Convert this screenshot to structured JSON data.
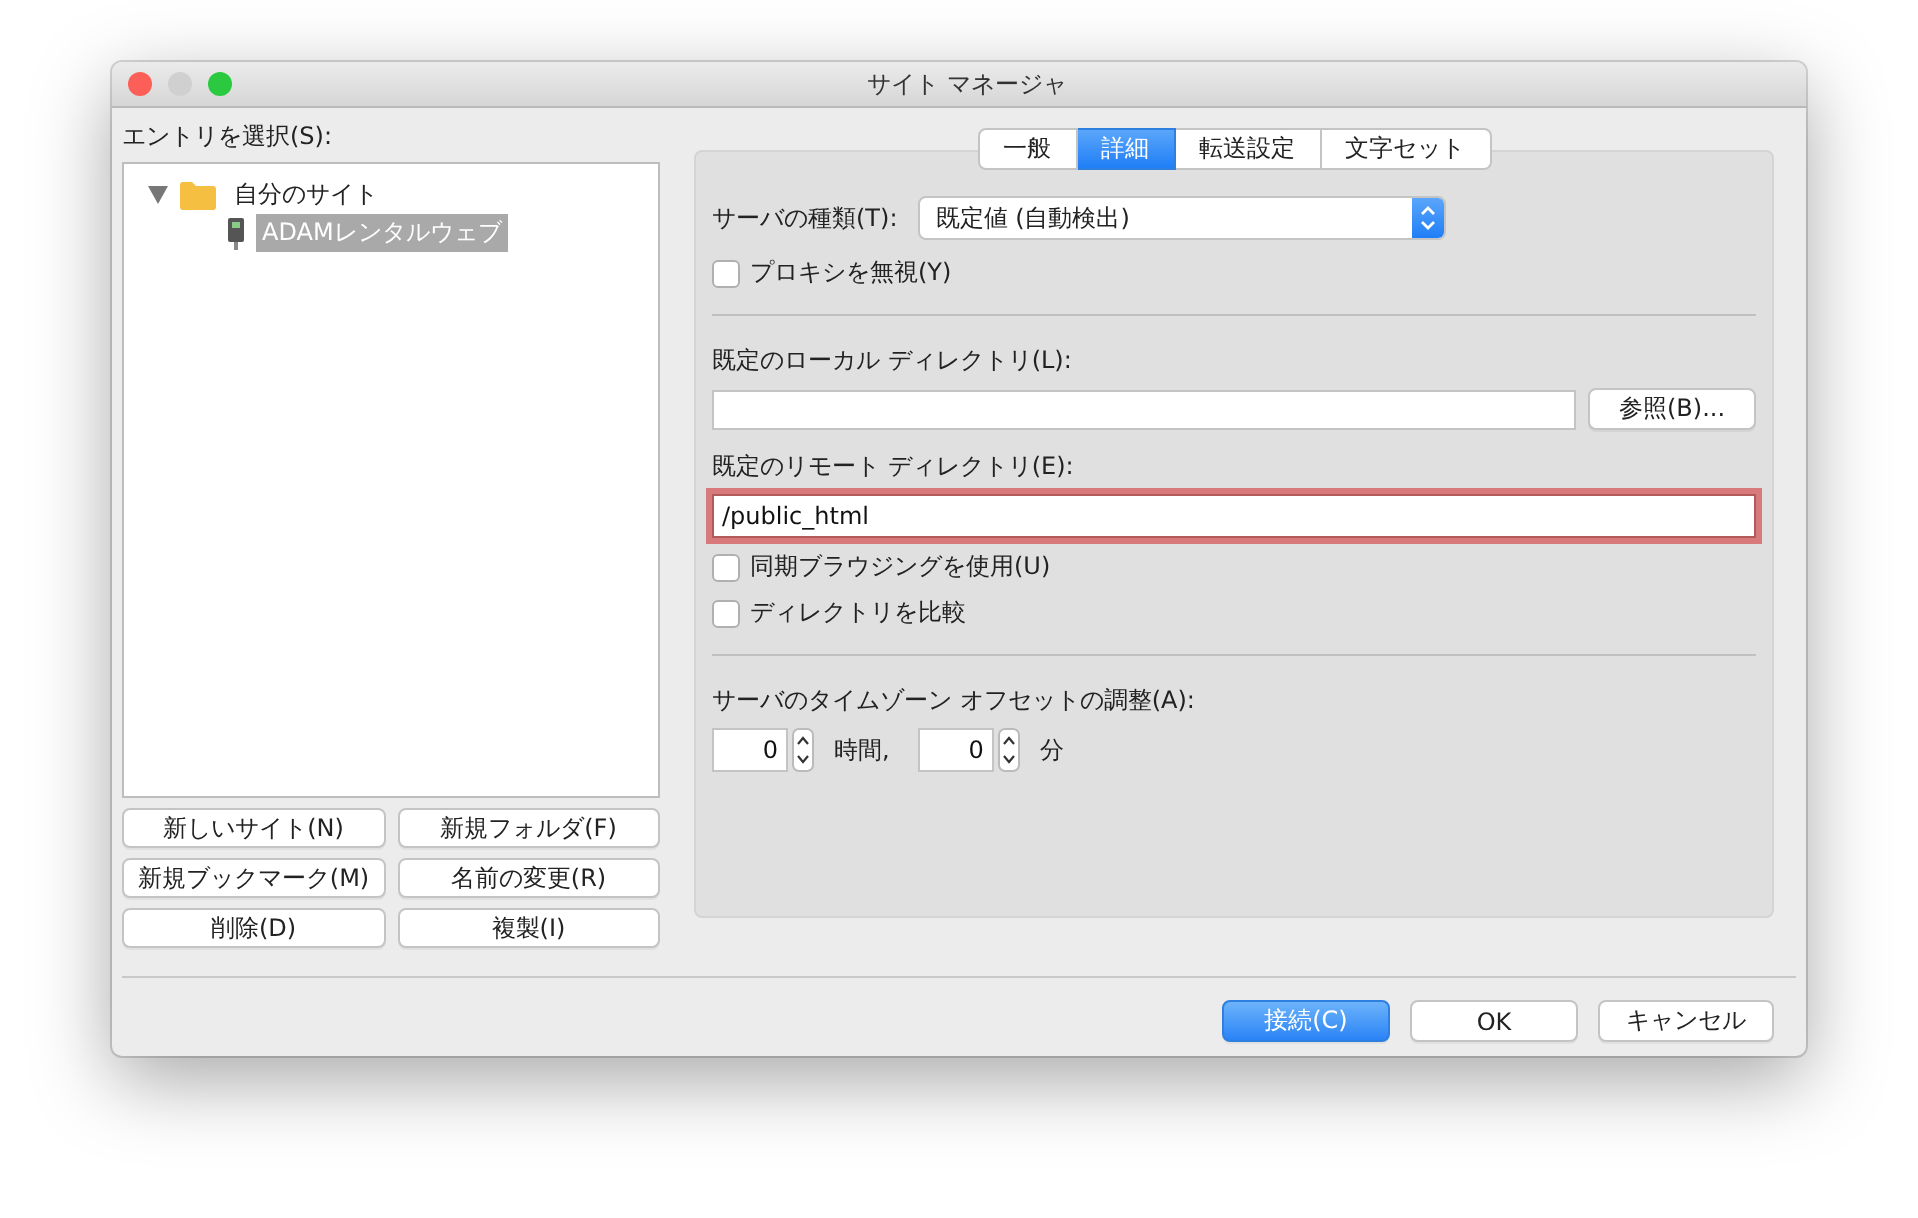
{
  "window": {
    "title": "サイト マネージャ"
  },
  "entries": {
    "label": "エントリを選択(S):",
    "tree": [
      {
        "label": "自分のサイト",
        "kind": "folder",
        "expanded": true,
        "selected": false,
        "children": [
          {
            "label": "ADAMレンタルウェブ",
            "kind": "site",
            "selected": true
          }
        ]
      }
    ]
  },
  "site_buttons": [
    "新しいサイト(N)",
    "新規フォルダ(F)",
    "新規ブックマーク(M)",
    "名前の変更(R)",
    "削除(D)",
    "複製(I)"
  ],
  "tabs": [
    {
      "label": "一般",
      "selected": false
    },
    {
      "label": "詳細",
      "selected": true
    },
    {
      "label": "転送設定",
      "selected": false
    },
    {
      "label": "文字セット",
      "selected": false
    }
  ],
  "server_type": {
    "label": "サーバの種類(T):",
    "value": "既定値 (自動検出)"
  },
  "proxy": {
    "label": "プロキシを無視(Y)",
    "checked": false
  },
  "local_dir": {
    "label": "既定のローカル ディレクトリ(L):",
    "button": "参照(B)..."
  },
  "remote_dir": {
    "label": "既定のリモート ディレクトリ(E):",
    "value": "/public_html",
    "focused": true
  },
  "options": [
    {
      "label": "同期ブラウジングを使用(U)",
      "checked": false
    },
    {
      "label": "ディレクトリを比較",
      "checked": false
    }
  ],
  "timezone": {
    "label": "サーバのタイムゾーン オフセットの調整(A):",
    "hours": "0",
    "hours_unit": "時間,",
    "minutes": "0",
    "minutes_unit": "分"
  },
  "footer_buttons": [
    {
      "label": "接続(C)",
      "primary": true
    },
    {
      "label": "OK",
      "primary": false
    },
    {
      "label": "キャンセル",
      "primary": false
    }
  ]
}
